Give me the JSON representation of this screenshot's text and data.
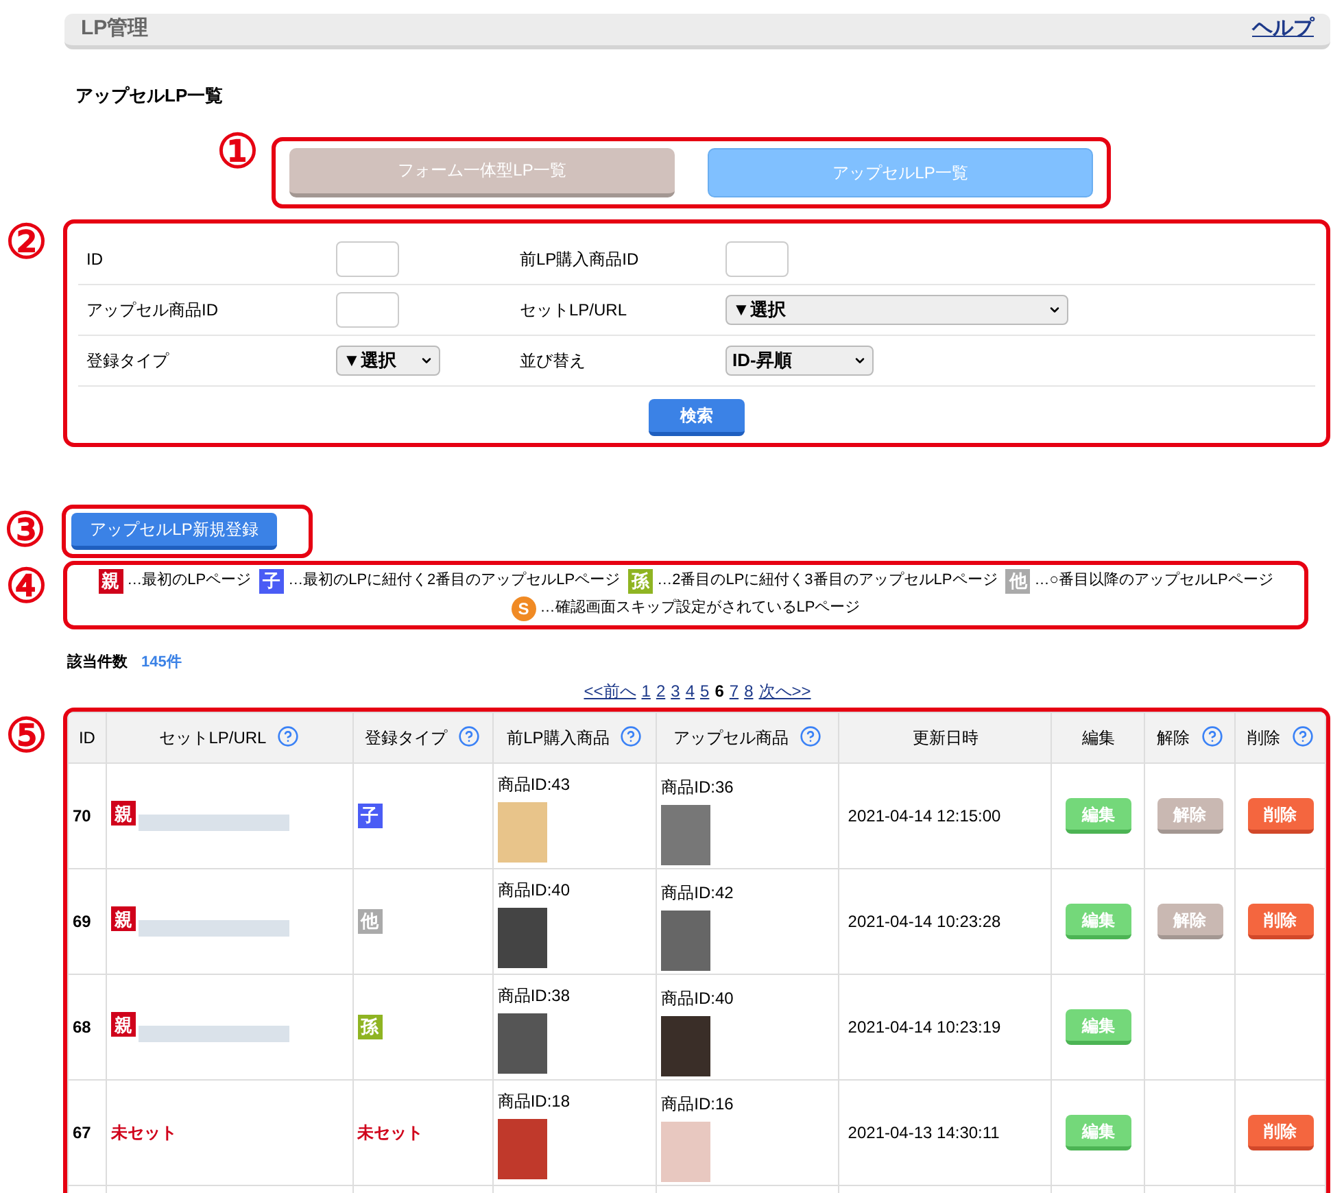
{
  "header": {
    "title": "LP管理",
    "help_link": "ヘルプ"
  },
  "page_title": "アップセルLP一覧",
  "annotations": [
    "①",
    "②",
    "③",
    "④",
    "⑤"
  ],
  "tabs": [
    {
      "label": "フォーム一体型LP一覧",
      "selected": false
    },
    {
      "label": "アップセルLP一覧",
      "selected": true
    }
  ],
  "search_form": {
    "rows": [
      [
        {
          "label": "ID",
          "kind": "input"
        },
        {
          "label": "前LP購入商品ID",
          "kind": "input"
        }
      ],
      [
        {
          "label": "アップセル商品ID",
          "kind": "input"
        },
        {
          "label": "セットLP/URL",
          "kind": "select",
          "value": "▼選択"
        }
      ],
      [
        {
          "label": "登録タイプ",
          "kind": "select",
          "value": "▼選択"
        },
        {
          "label": "並び替え",
          "kind": "select",
          "value": "ID-昇順"
        }
      ]
    ],
    "search_button": "検索"
  },
  "new_button": "アップセルLP新規登録",
  "legend": [
    {
      "kind": "square",
      "badge": "親",
      "color": "#d0021b",
      "text": "…最初のLPページ"
    },
    {
      "kind": "square",
      "badge": "子",
      "color": "#4a5cf5",
      "text": "…最初のLPに紐付く2番目のアップセルLPページ"
    },
    {
      "kind": "square",
      "badge": "孫",
      "color": "#8fb422",
      "text": "…2番目のLPに紐付く3番目のアップセルLPページ"
    },
    {
      "kind": "square",
      "badge": "他",
      "color": "#aaaaaa",
      "text": "…○番目以降のアップセルLPページ"
    },
    {
      "kind": "circle",
      "badge": "S",
      "color": "#f08a24",
      "text": "…確認画面スキップ設定がされているLPページ"
    }
  ],
  "result_count": {
    "label": "該当件数",
    "value": "145件"
  },
  "pagination": [
    {
      "label": "<<前へ",
      "selected": false
    },
    {
      "label": "1",
      "selected": false
    },
    {
      "label": "2",
      "selected": false
    },
    {
      "label": "3",
      "selected": false
    },
    {
      "label": "4",
      "selected": false
    },
    {
      "label": "5",
      "selected": false
    },
    {
      "label": "6",
      "selected": true
    },
    {
      "label": "7",
      "selected": false
    },
    {
      "label": "8",
      "selected": false
    },
    {
      "label": "次へ>>",
      "selected": false
    }
  ],
  "table": {
    "columns": [
      {
        "label": "ID",
        "help": false
      },
      {
        "label": "セットLP/URL",
        "help": true
      },
      {
        "label": "登録タイプ",
        "help": true
      },
      {
        "label": "前LP購入商品",
        "help": true
      },
      {
        "label": "アップセル商品",
        "help": true
      },
      {
        "label": "更新日時",
        "help": false
      },
      {
        "label": "編集",
        "help": false
      },
      {
        "label": "解除",
        "help": true
      },
      {
        "label": "削除",
        "help": true
      }
    ],
    "rows": [
      {
        "id": "70",
        "set_lp": {
          "kind": "badge",
          "text": "親",
          "color": "#d0021b"
        },
        "type": {
          "kind": "badge",
          "text": "子",
          "color": "#4a5cf5"
        },
        "prev_product": "商品ID:43",
        "upsell_product": "商品ID:36",
        "updated": "2021-04-14 12:15:00",
        "edit": "編集",
        "release": "解除",
        "delete": "削除"
      },
      {
        "id": "69",
        "set_lp": {
          "kind": "badge",
          "text": "親",
          "color": "#d0021b"
        },
        "type": {
          "kind": "badge",
          "text": "他",
          "color": "#aaaaaa"
        },
        "prev_product": "商品ID:40",
        "upsell_product": "商品ID:42",
        "updated": "2021-04-14 10:23:28",
        "edit": "編集",
        "release": "解除",
        "delete": "削除"
      },
      {
        "id": "68",
        "set_lp": {
          "kind": "badge",
          "text": "親",
          "color": "#d0021b"
        },
        "type": {
          "kind": "badge",
          "text": "孫",
          "color": "#8fb422"
        },
        "prev_product": "商品ID:38",
        "upsell_product": "商品ID:40",
        "updated": "2021-04-14 10:23:19",
        "edit": "編集"
      },
      {
        "id": "67",
        "set_lp": {
          "kind": "unset",
          "text": "未セット"
        },
        "type": {
          "kind": "unset",
          "text": "未セット"
        },
        "prev_product": "商品ID:18",
        "upsell_product": "商品ID:16",
        "updated": "2021-04-13 14:30:11",
        "edit": "編集",
        "delete": "削除"
      }
    ]
  }
}
